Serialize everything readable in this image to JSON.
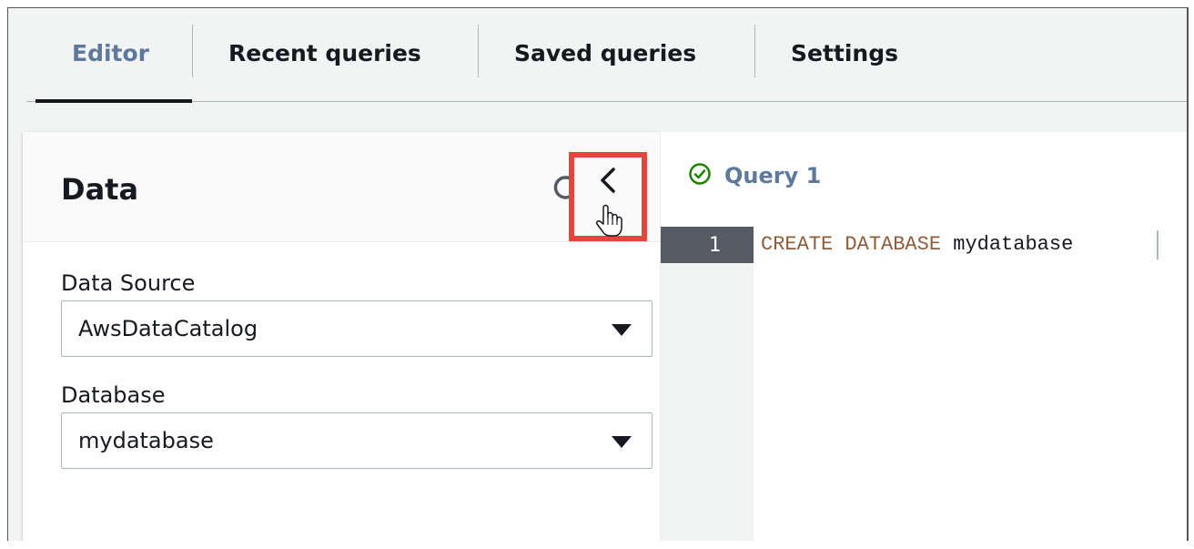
{
  "tabs": [
    {
      "label": "Editor",
      "active": true
    },
    {
      "label": "Recent queries",
      "active": false
    },
    {
      "label": "Saved queries",
      "active": false
    },
    {
      "label": "Settings",
      "active": false
    }
  ],
  "panel": {
    "title": "Data",
    "refresh_icon": "refresh-icon",
    "collapse_icon": "chevron-left-icon",
    "highlight_color": "#e4463b",
    "data_source": {
      "label": "Data Source",
      "value": "AwsDataCatalog"
    },
    "database": {
      "label": "Database",
      "value": "mydatabase"
    }
  },
  "editor": {
    "tab_label": "Query 1",
    "tab_status_icon": "check-circle-icon",
    "lines": [
      {
        "number": "1",
        "keyword1": "CREATE",
        "keyword2": "DATABASE",
        "identifier": "mydatabase"
      }
    ]
  },
  "colors": {
    "accent": "#5d7a9e",
    "success": "#1d8102",
    "keyword": "#8f5c3a"
  }
}
